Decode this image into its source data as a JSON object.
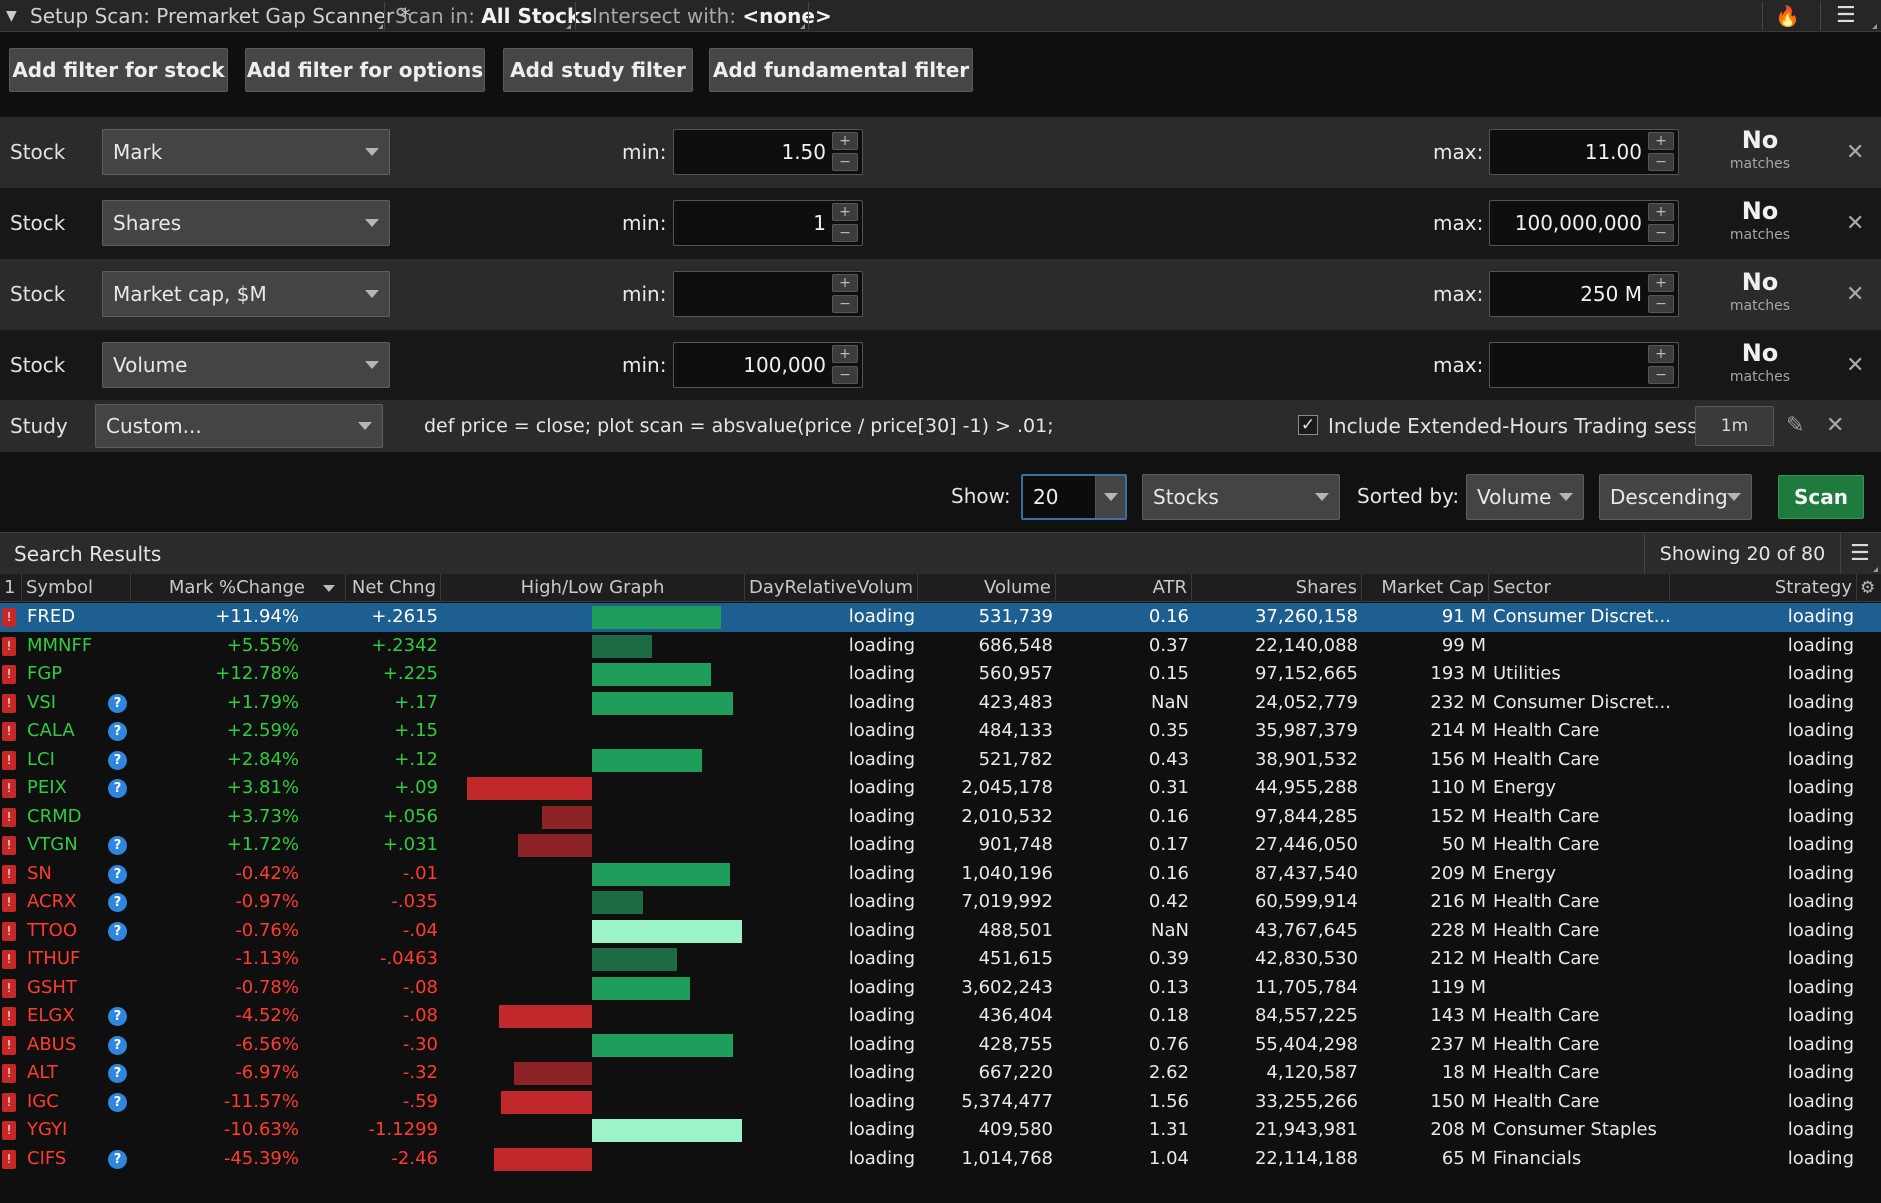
{
  "titlebar": {
    "setup_label": "Setup Scan: Premarket Gap Scanner *",
    "scan_in_prefix": "Scan in:",
    "scan_in_value": "All Stocks",
    "intersect_prefix": "Intersect with:",
    "intersect_value": "<none>"
  },
  "buttons": {
    "add_stock": "Add filter for stock",
    "add_options": "Add filter for options",
    "add_study": "Add study filter",
    "add_fundamental": "Add fundamental filter"
  },
  "filters": [
    {
      "type": "Stock",
      "field": "Mark",
      "min_label": "min:",
      "min": "1.50",
      "max_label": "max:",
      "max": "11.00",
      "status": "No",
      "status_sub": "matches"
    },
    {
      "type": "Stock",
      "field": "Shares",
      "min_label": "min:",
      "min": "1",
      "max_label": "max:",
      "max": "100,000,000",
      "status": "No",
      "status_sub": "matches"
    },
    {
      "type": "Stock",
      "field": "Market cap, $M",
      "min_label": "min:",
      "min": "",
      "max_label": "max:",
      "max": "250 M",
      "status": "No",
      "status_sub": "matches"
    },
    {
      "type": "Stock",
      "field": "Volume",
      "min_label": "min:",
      "min": "100,000",
      "max_label": "max:",
      "max": "",
      "status": "No",
      "status_sub": "matches"
    }
  ],
  "study": {
    "type": "Study",
    "field": "Custom...",
    "code": "def price = close; plot scan = absvalue(price / price[30] -1) > .01;",
    "extended_checked": "✓",
    "extended_label": "Include Extended-Hours Trading session",
    "aggregation": "1m"
  },
  "controls": {
    "show_label": "Show:",
    "show_value": "20",
    "asset_value": "Stocks",
    "sorted_label": "Sorted by:",
    "sort_field": "Volume",
    "sort_order": "Descending",
    "scan_label": "Scan"
  },
  "results": {
    "title": "Search Results",
    "showing": "Showing 20 of 80",
    "columns": {
      "num": "1",
      "symbol": "Symbol",
      "markchg": "Mark %Change",
      "netchg": "Net Chng",
      "graph": "High/Low Graph",
      "dayrel": "DayRelativeVolum",
      "volume": "Volume",
      "atr": "ATR",
      "shares": "Shares",
      "mcap": "Market Cap",
      "sector": "Sector",
      "strategy": "Strategy"
    },
    "rows": [
      {
        "symbol": "FRED",
        "info": false,
        "markchg": "+11.94%",
        "netchg": "+.2615",
        "dir": "pos",
        "bar": {
          "side": "up",
          "size": 0.86,
          "tone": "mid"
        },
        "dayrel": "loading",
        "volume": "531,739",
        "atr": "0.16",
        "shares": "37,260,158",
        "mcap": "91 M",
        "sector": "Consumer Discret...",
        "strategy": "loading",
        "selected": true
      },
      {
        "symbol": "MMNFF",
        "info": false,
        "markchg": "+5.55%",
        "netchg": "+.2342",
        "dir": "pos",
        "bar": {
          "side": "up",
          "size": 0.4,
          "tone": "dark"
        },
        "dayrel": "loading",
        "volume": "686,548",
        "atr": "0.37",
        "shares": "22,140,088",
        "mcap": "99 M",
        "sector": "",
        "strategy": "loading"
      },
      {
        "symbol": "FGP",
        "info": false,
        "markchg": "+12.78%",
        "netchg": "+.225",
        "dir": "pos",
        "bar": {
          "side": "up",
          "size": 0.79,
          "tone": "mid"
        },
        "dayrel": "loading",
        "volume": "560,957",
        "atr": "0.15",
        "shares": "97,152,665",
        "mcap": "193 M",
        "sector": "Utilities",
        "strategy": "loading"
      },
      {
        "symbol": "VSI",
        "info": true,
        "markchg": "+1.79%",
        "netchg": "+.17",
        "dir": "pos",
        "bar": {
          "side": "up",
          "size": 0.94,
          "tone": "mid"
        },
        "dayrel": "loading",
        "volume": "423,483",
        "atr": "NaN",
        "shares": "24,052,779",
        "mcap": "232 M",
        "sector": "Consumer Discret...",
        "strategy": "loading"
      },
      {
        "symbol": "CALA",
        "info": true,
        "markchg": "+2.59%",
        "netchg": "+.15",
        "dir": "pos",
        "bar": {
          "side": "none",
          "size": 0,
          "tone": "mid"
        },
        "dayrel": "loading",
        "volume": "484,133",
        "atr": "0.35",
        "shares": "35,987,379",
        "mcap": "214 M",
        "sector": "Health Care",
        "strategy": "loading"
      },
      {
        "symbol": "LCI",
        "info": true,
        "markchg": "+2.84%",
        "netchg": "+.12",
        "dir": "pos",
        "bar": {
          "side": "up",
          "size": 0.73,
          "tone": "mid"
        },
        "dayrel": "loading",
        "volume": "521,782",
        "atr": "0.43",
        "shares": "38,901,532",
        "mcap": "156 M",
        "sector": "Health Care",
        "strategy": "loading"
      },
      {
        "symbol": "PEIX",
        "info": true,
        "markchg": "+3.81%",
        "netchg": "+.09",
        "dir": "pos",
        "bar": {
          "side": "down",
          "size": 1.0,
          "tone": "red"
        },
        "dayrel": "loading",
        "volume": "2,045,178",
        "atr": "0.31",
        "shares": "44,955,288",
        "mcap": "110 M",
        "sector": "Energy",
        "strategy": "loading"
      },
      {
        "symbol": "CRMD",
        "info": false,
        "markchg": "+3.73%",
        "netchg": "+.056",
        "dir": "pos",
        "bar": {
          "side": "down",
          "size": 0.4,
          "tone": "darkred"
        },
        "dayrel": "loading",
        "volume": "2,010,532",
        "atr": "0.16",
        "shares": "97,844,285",
        "mcap": "152 M",
        "sector": "Health Care",
        "strategy": "loading"
      },
      {
        "symbol": "VTGN",
        "info": true,
        "markchg": "+1.72%",
        "netchg": "+.031",
        "dir": "pos",
        "bar": {
          "side": "down",
          "size": 0.59,
          "tone": "darkred"
        },
        "dayrel": "loading",
        "volume": "901,748",
        "atr": "0.17",
        "shares": "27,446,050",
        "mcap": "50 M",
        "sector": "Health Care",
        "strategy": "loading"
      },
      {
        "symbol": "SN",
        "info": true,
        "markchg": "-0.42%",
        "netchg": "-.01",
        "dir": "neg",
        "bar": {
          "side": "up",
          "size": 0.92,
          "tone": "mid"
        },
        "dayrel": "loading",
        "volume": "1,040,196",
        "atr": "0.16",
        "shares": "87,437,540",
        "mcap": "209 M",
        "sector": "Energy",
        "strategy": "loading"
      },
      {
        "symbol": "ACRX",
        "info": true,
        "markchg": "-0.97%",
        "netchg": "-.035",
        "dir": "neg",
        "bar": {
          "side": "up",
          "size": 0.34,
          "tone": "dark"
        },
        "dayrel": "loading",
        "volume": "7,019,992",
        "atr": "0.42",
        "shares": "60,599,914",
        "mcap": "216 M",
        "sector": "Health Care",
        "strategy": "loading"
      },
      {
        "symbol": "TTOO",
        "info": true,
        "markchg": "-0.76%",
        "netchg": "-.04",
        "dir": "neg",
        "bar": {
          "side": "up",
          "size": 1.0,
          "tone": "light"
        },
        "dayrel": "loading",
        "volume": "488,501",
        "atr": "NaN",
        "shares": "43,767,645",
        "mcap": "228 M",
        "sector": "Health Care",
        "strategy": "loading"
      },
      {
        "symbol": "ITHUF",
        "info": false,
        "markchg": "-1.13%",
        "netchg": "-.0463",
        "dir": "neg",
        "bar": {
          "side": "up",
          "size": 0.57,
          "tone": "dark"
        },
        "dayrel": "loading",
        "volume": "451,615",
        "atr": "0.39",
        "shares": "42,830,530",
        "mcap": "212 M",
        "sector": "Health Care",
        "strategy": "loading"
      },
      {
        "symbol": "GSHT",
        "info": false,
        "markchg": "-0.78%",
        "netchg": "-.08",
        "dir": "neg",
        "bar": {
          "side": "up",
          "size": 0.65,
          "tone": "mid"
        },
        "dayrel": "loading",
        "volume": "3,602,243",
        "atr": "0.13",
        "shares": "11,705,784",
        "mcap": "119 M",
        "sector": "",
        "strategy": "loading"
      },
      {
        "symbol": "ELGX",
        "info": true,
        "markchg": "-4.52%",
        "netchg": "-.08",
        "dir": "neg",
        "bar": {
          "side": "down",
          "size": 0.74,
          "tone": "red"
        },
        "dayrel": "loading",
        "volume": "436,404",
        "atr": "0.18",
        "shares": "84,557,225",
        "mcap": "143 M",
        "sector": "Health Care",
        "strategy": "loading"
      },
      {
        "symbol": "ABUS",
        "info": true,
        "markchg": "-6.56%",
        "netchg": "-.30",
        "dir": "neg",
        "bar": {
          "side": "up",
          "size": 0.94,
          "tone": "mid"
        },
        "dayrel": "loading",
        "volume": "428,755",
        "atr": "0.76",
        "shares": "55,404,298",
        "mcap": "237 M",
        "sector": "Health Care",
        "strategy": "loading"
      },
      {
        "symbol": "ALT",
        "info": true,
        "markchg": "-6.97%",
        "netchg": "-.32",
        "dir": "neg",
        "bar": {
          "side": "down",
          "size": 0.62,
          "tone": "darkred"
        },
        "dayrel": "loading",
        "volume": "667,220",
        "atr": "2.62",
        "shares": "4,120,587",
        "mcap": "18 M",
        "sector": "Health Care",
        "strategy": "loading"
      },
      {
        "symbol": "IGC",
        "info": true,
        "markchg": "-11.57%",
        "netchg": "-.59",
        "dir": "neg",
        "bar": {
          "side": "down",
          "size": 0.73,
          "tone": "red"
        },
        "dayrel": "loading",
        "volume": "5,374,477",
        "atr": "1.56",
        "shares": "33,255,266",
        "mcap": "150 M",
        "sector": "Health Care",
        "strategy": "loading"
      },
      {
        "symbol": "YGYI",
        "info": false,
        "markchg": "-10.63%",
        "netchg": "-1.1299",
        "dir": "neg",
        "bar": {
          "side": "up",
          "size": 1.0,
          "tone": "light"
        },
        "dayrel": "loading",
        "volume": "409,580",
        "atr": "1.31",
        "shares": "21,943,981",
        "mcap": "208 M",
        "sector": "Consumer Staples",
        "strategy": "loading"
      },
      {
        "symbol": "CIFS",
        "info": true,
        "markchg": "-45.39%",
        "netchg": "-2.46",
        "dir": "neg",
        "bar": {
          "side": "down",
          "size": 0.78,
          "tone": "red"
        },
        "dayrel": "loading",
        "volume": "1,014,768",
        "atr": "1.04",
        "shares": "22,114,188",
        "mcap": "65 M",
        "sector": "Financials",
        "strategy": "loading"
      }
    ]
  },
  "colors": {
    "positive": "#2ecc40",
    "negative": "#ff3b30",
    "selected_row": "#1e5f91",
    "scan_button": "#1e7a3d",
    "bar_mid": "#1e9e5a",
    "bar_dark": "#1c6b45",
    "bar_light": "#9cf3c8",
    "bar_red": "#c0282c",
    "bar_darkred": "#8e2327"
  },
  "icons": {
    "collapse": "chevron-down-icon",
    "flame": "flame-icon",
    "menu": "list-menu-icon",
    "alert_flag": "alert-flag-icon",
    "info": "info-icon",
    "close": "close-icon",
    "edit": "pencil-icon",
    "settings": "gear-icon"
  }
}
